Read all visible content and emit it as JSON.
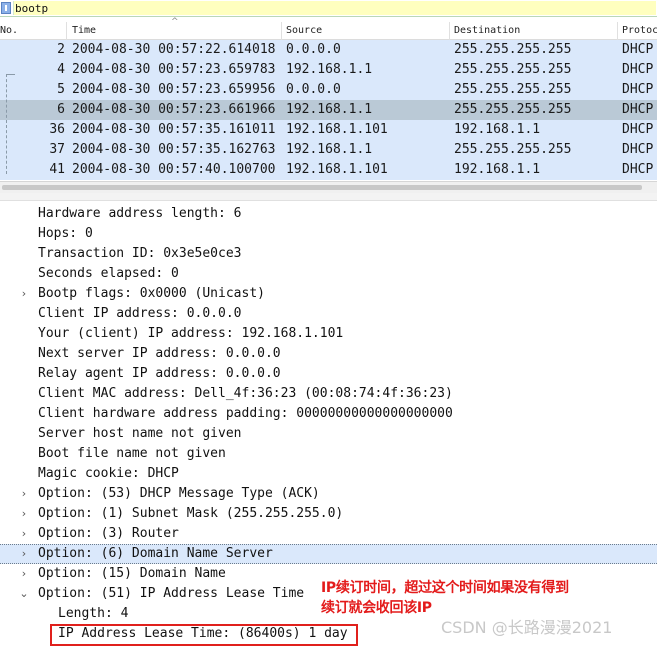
{
  "filter": {
    "value": "bootp"
  },
  "columns": {
    "no": "No.",
    "time": "Time",
    "source": "Source",
    "destination": "Destination",
    "protocol": "Protoc"
  },
  "packets": [
    {
      "no": "2",
      "time": "2004-08-30 00:57:22.614018",
      "source": "0.0.0.0",
      "destination": "255.255.255.255",
      "protocol": "DHCP"
    },
    {
      "no": "4",
      "time": "2004-08-30 00:57:23.659783",
      "source": "192.168.1.1",
      "destination": "255.255.255.255",
      "protocol": "DHCP"
    },
    {
      "no": "5",
      "time": "2004-08-30 00:57:23.659956",
      "source": "0.0.0.0",
      "destination": "255.255.255.255",
      "protocol": "DHCP"
    },
    {
      "no": "6",
      "time": "2004-08-30 00:57:23.661966",
      "source": "192.168.1.1",
      "destination": "255.255.255.255",
      "protocol": "DHCP"
    },
    {
      "no": "36",
      "time": "2004-08-30 00:57:35.161011",
      "source": "192.168.1.101",
      "destination": "192.168.1.1",
      "protocol": "DHCP"
    },
    {
      "no": "37",
      "time": "2004-08-30 00:57:35.162763",
      "source": "192.168.1.1",
      "destination": "255.255.255.255",
      "protocol": "DHCP"
    },
    {
      "no": "41",
      "time": "2004-08-30 00:57:40.100700",
      "source": "192.168.1.101",
      "destination": "192.168.1.1",
      "protocol": "DHCP"
    }
  ],
  "selected_packet_index": 3,
  "details": [
    {
      "text": "Hardware address length: 6"
    },
    {
      "text": "Hops: 0"
    },
    {
      "text": "Transaction ID: 0x3e5e0ce3"
    },
    {
      "text": "Seconds elapsed: 0"
    },
    {
      "text": "Bootp flags: 0x0000 (Unicast)"
    },
    {
      "text": "Client IP address: 0.0.0.0"
    },
    {
      "text": "Your (client) IP address: 192.168.1.101"
    },
    {
      "text": "Next server IP address: 0.0.0.0"
    },
    {
      "text": "Relay agent IP address: 0.0.0.0"
    },
    {
      "text": "Client MAC address: Dell_4f:36:23 (00:08:74:4f:36:23)"
    },
    {
      "text": "Client hardware address padding: 00000000000000000000"
    },
    {
      "text": "Server host name not given"
    },
    {
      "text": "Boot file name not given"
    },
    {
      "text": "Magic cookie: DHCP"
    },
    {
      "text": "Option: (53) DHCP Message Type (ACK)"
    },
    {
      "text": "Option: (1) Subnet Mask (255.255.255.0)"
    },
    {
      "text": "Option: (3) Router"
    },
    {
      "text": "Option: (6) Domain Name Server"
    },
    {
      "text": "Option: (15) Domain Name"
    },
    {
      "text": "Option: (51) IP Address Lease Time"
    },
    {
      "text": "Length: 4"
    },
    {
      "text": "IP Address Lease Time: (86400s) 1 day"
    }
  ],
  "annotation": {
    "line1": "IP续订时间，超过这个时间如果没有得到",
    "line2": "续订就会收回该IP"
  },
  "watermark": "CSDN @长路漫漫2021"
}
